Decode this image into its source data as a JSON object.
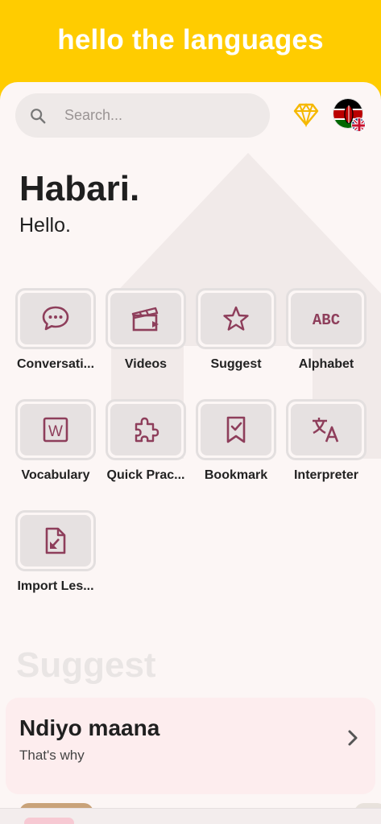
{
  "header": {
    "title": "hello the languages"
  },
  "search": {
    "placeholder": "Search..."
  },
  "greeting": {
    "title": "Habari.",
    "subtitle": "Hello."
  },
  "features": [
    {
      "label": "Conversati...",
      "icon": "chat-bubble-icon"
    },
    {
      "label": "Videos",
      "icon": "clapperboard-icon"
    },
    {
      "label": "Suggest",
      "icon": "star-icon"
    },
    {
      "label": "Alphabet",
      "icon": "abc-icon"
    },
    {
      "label": "Vocabulary",
      "icon": "word-document-icon"
    },
    {
      "label": "Quick Prac...",
      "icon": "puzzle-icon"
    },
    {
      "label": "Bookmark",
      "icon": "bookmark-check-icon"
    },
    {
      "label": "Interpreter",
      "icon": "translate-icon"
    },
    {
      "label": "Import Les...",
      "icon": "file-import-icon"
    }
  ],
  "suggest": {
    "heading": "Suggest",
    "card": {
      "title": "Ndiyo maana",
      "subtitle": "That's why"
    }
  },
  "colors": {
    "brand_yellow": "#FFCC00",
    "icon_maroon": "#8E3E5B",
    "background": "#FCF6F5",
    "card_pink": "#FDEDEE"
  }
}
